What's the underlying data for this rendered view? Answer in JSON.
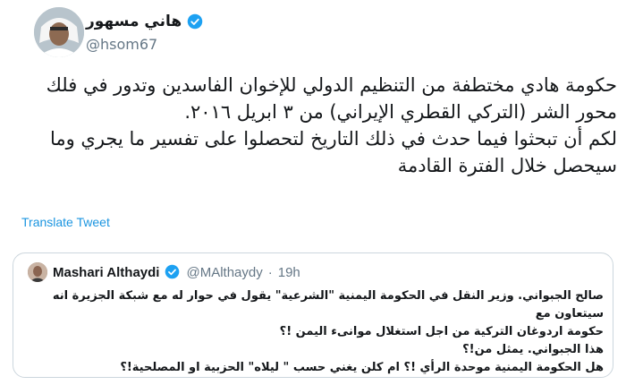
{
  "author": {
    "name": "هاني مسهور",
    "handle": "@hsom67",
    "verified": true
  },
  "tweet": {
    "lines": [
      "حكومة هادي مختطفة من التنظيم الدولي للإخوان الفاسدين وتدور في فلك",
      "محور الشر (التركي القطري الإيراني) من ٣ ابريل ٢٠١٦.",
      "لكم أن تبحثوا فيما حدث في ذلك التاريخ لتحصلوا على تفسير ما يجري وما",
      "سيحصل خلال الفترة القادمة"
    ],
    "translate_label": "Translate Tweet"
  },
  "quoted": {
    "name": "Mashari Althaydi",
    "handle": "@MAlthaydy",
    "separator": "·",
    "time": "19h",
    "verified": true,
    "lines": [
      "صالح الجبواني.  وزير النقل في الحكومة اليمنية \"الشرعية\" يقول في حوار له مع شبكة الجزيرة انه سيتعاون مع",
      "حكومة اردوغان التركية من اجل استغلال موانىء اليمن !؟",
      "هذا الجبواني.  يمثل من!؟",
      "هل الحكومة اليمنية موحدة الرأي !؟ ام كلن يغني حسب \" ليلاه\" الحزبية او المصلحية!؟"
    ]
  },
  "colors": {
    "verified_blue": "#1da1f2",
    "link_blue": "#1b95e0",
    "muted": "#657786",
    "border": "#ccd6dd"
  }
}
